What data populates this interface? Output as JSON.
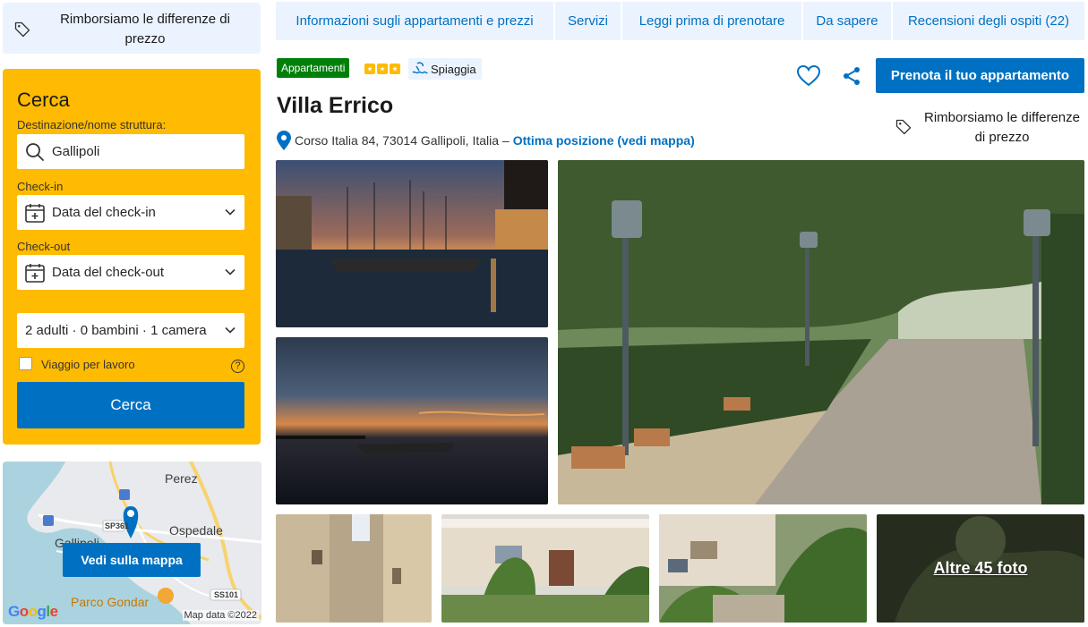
{
  "refund_banner": {
    "text": "Rimborsiamo le differenze di prezzo"
  },
  "search": {
    "title": "Cerca",
    "destination_label": "Destinazione/nome struttura:",
    "destination_value": "Gallipoli",
    "checkin_label": "Check-in",
    "checkin_value": "Data del check-in",
    "checkout_label": "Check-out",
    "checkout_value": "Data del check-out",
    "occupancy_value": "2 adulti · 0 bambini · 1 camera",
    "business_label": "Viaggio per lavoro",
    "help_symbol": "?",
    "button_label": "Cerca"
  },
  "map": {
    "labels": [
      "Perez",
      "Ospedale",
      "Gallipoli",
      "Parco Gondar"
    ],
    "road_labels": [
      "SP361",
      "SS101"
    ],
    "button_label": "Vedi sulla mappa",
    "google": "Google",
    "attribution": "Map data ©2022"
  },
  "tabs": [
    "Informazioni sugli appartamenti e prezzi",
    "Servizi",
    "Leggi prima di prenotare",
    "Da sapere",
    "Recensioni degli ospiti (22)"
  ],
  "property": {
    "type_badge": "Appartamenti",
    "stars": 3,
    "beach_label": "Spiaggia",
    "name": "Villa Errico",
    "address": "Corso Italia 84, 73014 Gallipoli, Italia –",
    "location_link": "Ottima posizione (vedi mappa)",
    "book_button": "Prenota il tuo appartamento",
    "refund_text": "Rimborsiamo le differenze di prezzo"
  },
  "gallery": {
    "more_photos": "Altre 45 foto"
  },
  "colors": {
    "brand_blue": "#0071c2",
    "search_yellow": "#febb02",
    "tab_bg": "#ebf3ff",
    "badge_green": "#008009"
  }
}
